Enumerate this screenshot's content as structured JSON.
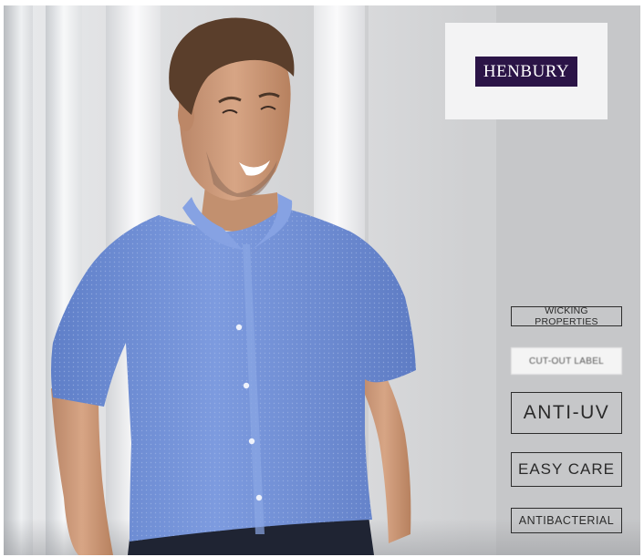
{
  "brand": {
    "logo_text": "HENBURY"
  },
  "features": [
    "WICKING PROPERTIES",
    "CUT-OUT LABEL",
    "ANTI-UV",
    "EASY CARE",
    "ANTIBACTERIAL"
  ],
  "colors": {
    "logo_background": "#2b1447",
    "shirt": "#6f8fd6",
    "panel": "#c6c7c9"
  }
}
